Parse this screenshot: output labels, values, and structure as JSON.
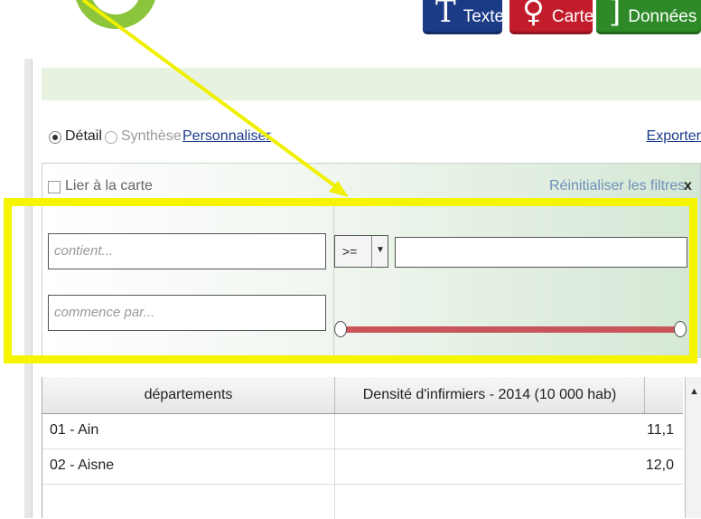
{
  "topbar": {
    "textes_label": "Textes",
    "cartes_label": "Cartes",
    "donnees_label": "Données",
    "textes_icon": "T",
    "cartes_icon": "♀",
    "donnees_icon": "[ ]"
  },
  "view": {
    "detail_label": "Détail",
    "synthese_label": "Synthèse",
    "personnaliser_label": "Personnaliser",
    "exporter_label": "Exporter",
    "selected": "Détail"
  },
  "filters": {
    "lier_label": "Lier à la carte",
    "reinit_label": "Réinitialiser les filtres",
    "close_label": "x",
    "contient_placeholder": "contient...",
    "commence_placeholder": "commence par...",
    "operator": ">=",
    "operator_arrow": "▼",
    "value": ""
  },
  "table": {
    "headers": [
      "départements",
      "Densité d'infirmiers - 2014 (10 000 hab)"
    ],
    "rows": [
      [
        "01 - Ain",
        "11,1"
      ],
      [
        "02 - Aisne",
        "12,0"
      ]
    ],
    "scroll_up": "▲"
  },
  "colors": {
    "highlight": "#f5f500",
    "textes_btn": "#1b3b87",
    "cartes_btn": "#c21b2a",
    "donnees_btn": "#2e8a28",
    "slider": "#c8555a"
  }
}
